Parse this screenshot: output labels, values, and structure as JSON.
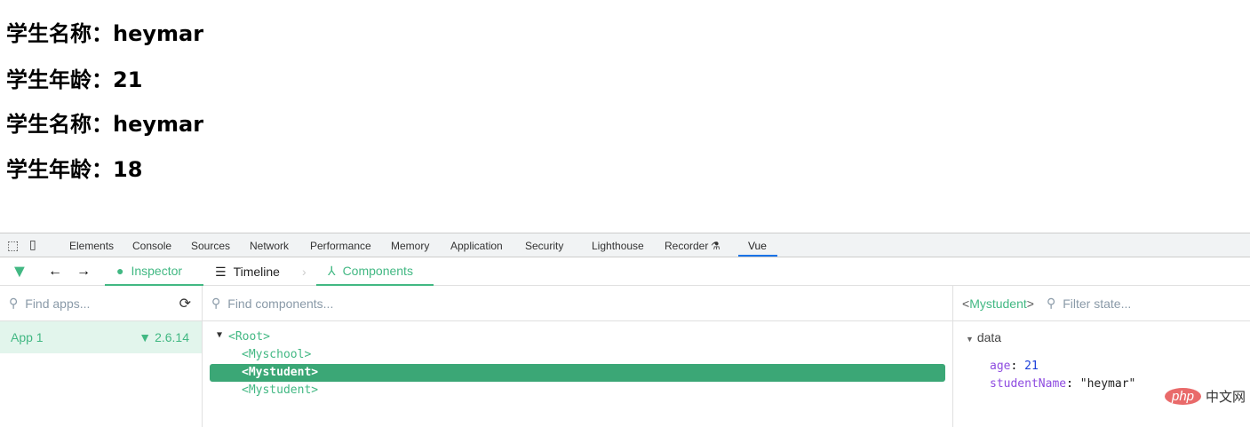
{
  "page": {
    "lines": [
      "学生名称：heymar",
      "学生年龄：21",
      "学生名称：heymar",
      "学生年龄：18"
    ]
  },
  "devtools_tabs": [
    "Elements",
    "Console",
    "Sources",
    "Network",
    "Performance",
    "Memory",
    "Application",
    "Security",
    "Lighthouse",
    "Recorder",
    "Vue"
  ],
  "vue_toolbar": {
    "inspector": "Inspector",
    "timeline": "Timeline",
    "components": "Components"
  },
  "apps": {
    "placeholder": "Find apps...",
    "items": [
      {
        "name": "App 1",
        "version": "2.6.14"
      }
    ]
  },
  "components": {
    "placeholder": "Find components...",
    "tree": [
      "<Root>",
      "<Myschool>",
      "<Mystudent>",
      "<Mystudent>"
    ]
  },
  "state": {
    "selected": "Mystudent",
    "placeholder": "Filter state...",
    "section": "data",
    "fields": [
      {
        "key": "age",
        "value": "21"
      },
      {
        "key": "studentName",
        "value": "\"heymar\""
      }
    ]
  },
  "watermark": {
    "text": "php",
    "text2": "中文网"
  }
}
